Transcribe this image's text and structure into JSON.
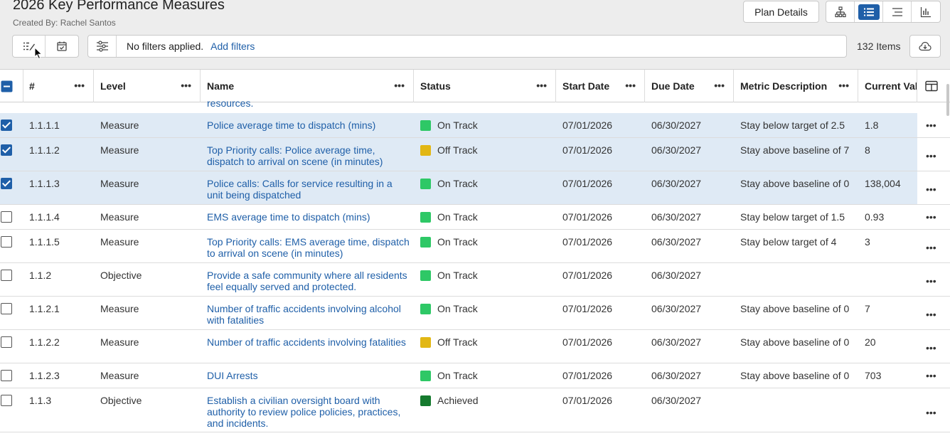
{
  "header": {
    "title": "2026 Key Performance Measures",
    "created_by": "Created By: Rachel Santos",
    "plan_details_label": "Plan Details"
  },
  "view_buttons": [
    {
      "icon": "hierarchy-icon"
    },
    {
      "icon": "list-view-icon",
      "active": true
    },
    {
      "icon": "align-icon"
    },
    {
      "icon": "bar-chart-icon"
    }
  ],
  "toolbar": {
    "filter_text": "No filters applied.",
    "add_filters_label": "Add filters",
    "items_count": "132 Items"
  },
  "columns": [
    "#",
    "Level",
    "Name",
    "Status",
    "Start Date",
    "Due Date",
    "Metric Description",
    "Current Value"
  ],
  "partial_row_text": "resources.",
  "colors": {
    "on_track": "#2ec866",
    "off_track": "#e2b714",
    "achieved": "#157a2e",
    "link": "#1f5fa8",
    "selected_row": "#dfeaf5"
  },
  "rows": [
    {
      "checked": true,
      "num": "1.1.1.1",
      "level": "Measure",
      "name": "Police average time to dispatch (mins)",
      "status": "On Track",
      "start": "07/01/2026",
      "due": "06/30/2027",
      "desc": "Stay below target of 2.5",
      "value": "1.8"
    },
    {
      "checked": true,
      "num": "1.1.1.2",
      "level": "Measure",
      "name": "Top Priority calls: Police average time, dispatch to arrival on scene (in minutes)",
      "status": "Off Track",
      "start": "07/01/2026",
      "due": "06/30/2027",
      "desc": "Stay above baseline of 7",
      "value": "8"
    },
    {
      "checked": true,
      "num": "1.1.1.3",
      "level": "Measure",
      "name": "Police calls: Calls for service resulting in a unit being dispatched",
      "status": "On Track",
      "start": "07/01/2026",
      "due": "06/30/2027",
      "desc": "Stay above baseline of 0",
      "value": "138,004"
    },
    {
      "checked": false,
      "num": "1.1.1.4",
      "level": "Measure",
      "name": "EMS average time to dispatch (mins)",
      "status": "On Track",
      "start": "07/01/2026",
      "due": "06/30/2027",
      "desc": "Stay below target of 1.5",
      "value": "0.93"
    },
    {
      "checked": false,
      "num": "1.1.1.5",
      "level": "Measure",
      "name": "Top Priority calls: EMS average time, dispatch to arrival on scene (in minutes)",
      "status": "On Track",
      "start": "07/01/2026",
      "due": "06/30/2027",
      "desc": "Stay below target of 4",
      "value": "3"
    },
    {
      "checked": false,
      "num": "1.1.2",
      "level": "Objective",
      "name": "Provide a safe community where all residents feel equally served and protected.",
      "status": "On Track",
      "start": "07/01/2026",
      "due": "06/30/2027",
      "desc": "",
      "value": ""
    },
    {
      "checked": false,
      "num": "1.1.2.1",
      "level": "Measure",
      "name": "Number of traffic accidents involving alcohol with fatalities",
      "status": "On Track",
      "start": "07/01/2026",
      "due": "06/30/2027",
      "desc": "Stay above baseline of 0",
      "value": "7"
    },
    {
      "checked": false,
      "num": "1.1.2.2",
      "level": "Measure",
      "name": "Number of traffic accidents involving fatalities",
      "status": "Off Track",
      "start": "07/01/2026",
      "due": "06/30/2027",
      "desc": "Stay above baseline of 0",
      "value": "20"
    },
    {
      "checked": false,
      "num": "1.1.2.3",
      "level": "Measure",
      "name": "DUI Arrests",
      "status": "On Track",
      "start": "07/01/2026",
      "due": "06/30/2027",
      "desc": "Stay above baseline of 0",
      "value": "703"
    },
    {
      "checked": false,
      "num": "1.1.3",
      "level": "Objective",
      "name": "Establish a civilian oversight board with authority to review police policies, practices, and incidents.",
      "status": "Achieved",
      "start": "07/01/2026",
      "due": "06/30/2027",
      "desc": "",
      "value": ""
    }
  ]
}
